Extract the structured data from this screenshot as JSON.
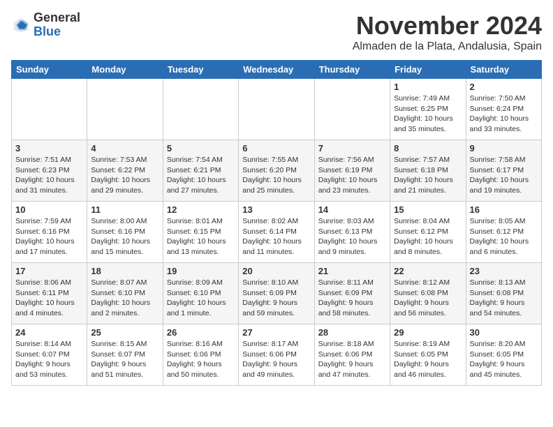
{
  "logo": {
    "general": "General",
    "blue": "Blue"
  },
  "title": "November 2024",
  "location": "Almaden de la Plata, Andalusia, Spain",
  "headers": [
    "Sunday",
    "Monday",
    "Tuesday",
    "Wednesday",
    "Thursday",
    "Friday",
    "Saturday"
  ],
  "weeks": [
    [
      {
        "day": "",
        "info": ""
      },
      {
        "day": "",
        "info": ""
      },
      {
        "day": "",
        "info": ""
      },
      {
        "day": "",
        "info": ""
      },
      {
        "day": "",
        "info": ""
      },
      {
        "day": "1",
        "info": "Sunrise: 7:49 AM\nSunset: 6:25 PM\nDaylight: 10 hours\nand 35 minutes."
      },
      {
        "day": "2",
        "info": "Sunrise: 7:50 AM\nSunset: 6:24 PM\nDaylight: 10 hours\nand 33 minutes."
      }
    ],
    [
      {
        "day": "3",
        "info": "Sunrise: 7:51 AM\nSunset: 6:23 PM\nDaylight: 10 hours\nand 31 minutes."
      },
      {
        "day": "4",
        "info": "Sunrise: 7:53 AM\nSunset: 6:22 PM\nDaylight: 10 hours\nand 29 minutes."
      },
      {
        "day": "5",
        "info": "Sunrise: 7:54 AM\nSunset: 6:21 PM\nDaylight: 10 hours\nand 27 minutes."
      },
      {
        "day": "6",
        "info": "Sunrise: 7:55 AM\nSunset: 6:20 PM\nDaylight: 10 hours\nand 25 minutes."
      },
      {
        "day": "7",
        "info": "Sunrise: 7:56 AM\nSunset: 6:19 PM\nDaylight: 10 hours\nand 23 minutes."
      },
      {
        "day": "8",
        "info": "Sunrise: 7:57 AM\nSunset: 6:18 PM\nDaylight: 10 hours\nand 21 minutes."
      },
      {
        "day": "9",
        "info": "Sunrise: 7:58 AM\nSunset: 6:17 PM\nDaylight: 10 hours\nand 19 minutes."
      }
    ],
    [
      {
        "day": "10",
        "info": "Sunrise: 7:59 AM\nSunset: 6:16 PM\nDaylight: 10 hours\nand 17 minutes."
      },
      {
        "day": "11",
        "info": "Sunrise: 8:00 AM\nSunset: 6:16 PM\nDaylight: 10 hours\nand 15 minutes."
      },
      {
        "day": "12",
        "info": "Sunrise: 8:01 AM\nSunset: 6:15 PM\nDaylight: 10 hours\nand 13 minutes."
      },
      {
        "day": "13",
        "info": "Sunrise: 8:02 AM\nSunset: 6:14 PM\nDaylight: 10 hours\nand 11 minutes."
      },
      {
        "day": "14",
        "info": "Sunrise: 8:03 AM\nSunset: 6:13 PM\nDaylight: 10 hours\nand 9 minutes."
      },
      {
        "day": "15",
        "info": "Sunrise: 8:04 AM\nSunset: 6:12 PM\nDaylight: 10 hours\nand 8 minutes."
      },
      {
        "day": "16",
        "info": "Sunrise: 8:05 AM\nSunset: 6:12 PM\nDaylight: 10 hours\nand 6 minutes."
      }
    ],
    [
      {
        "day": "17",
        "info": "Sunrise: 8:06 AM\nSunset: 6:11 PM\nDaylight: 10 hours\nand 4 minutes."
      },
      {
        "day": "18",
        "info": "Sunrise: 8:07 AM\nSunset: 6:10 PM\nDaylight: 10 hours\nand 2 minutes."
      },
      {
        "day": "19",
        "info": "Sunrise: 8:09 AM\nSunset: 6:10 PM\nDaylight: 10 hours\nand 1 minute."
      },
      {
        "day": "20",
        "info": "Sunrise: 8:10 AM\nSunset: 6:09 PM\nDaylight: 9 hours\nand 59 minutes."
      },
      {
        "day": "21",
        "info": "Sunrise: 8:11 AM\nSunset: 6:09 PM\nDaylight: 9 hours\nand 58 minutes."
      },
      {
        "day": "22",
        "info": "Sunrise: 8:12 AM\nSunset: 6:08 PM\nDaylight: 9 hours\nand 56 minutes."
      },
      {
        "day": "23",
        "info": "Sunrise: 8:13 AM\nSunset: 6:08 PM\nDaylight: 9 hours\nand 54 minutes."
      }
    ],
    [
      {
        "day": "24",
        "info": "Sunrise: 8:14 AM\nSunset: 6:07 PM\nDaylight: 9 hours\nand 53 minutes."
      },
      {
        "day": "25",
        "info": "Sunrise: 8:15 AM\nSunset: 6:07 PM\nDaylight: 9 hours\nand 51 minutes."
      },
      {
        "day": "26",
        "info": "Sunrise: 8:16 AM\nSunset: 6:06 PM\nDaylight: 9 hours\nand 50 minutes."
      },
      {
        "day": "27",
        "info": "Sunrise: 8:17 AM\nSunset: 6:06 PM\nDaylight: 9 hours\nand 49 minutes."
      },
      {
        "day": "28",
        "info": "Sunrise: 8:18 AM\nSunset: 6:06 PM\nDaylight: 9 hours\nand 47 minutes."
      },
      {
        "day": "29",
        "info": "Sunrise: 8:19 AM\nSunset: 6:05 PM\nDaylight: 9 hours\nand 46 minutes."
      },
      {
        "day": "30",
        "info": "Sunrise: 8:20 AM\nSunset: 6:05 PM\nDaylight: 9 hours\nand 45 minutes."
      }
    ]
  ]
}
